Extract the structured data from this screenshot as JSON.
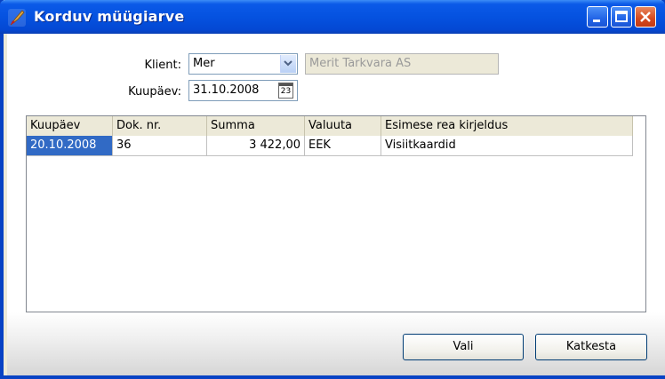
{
  "window": {
    "title": "Korduv müügiarve"
  },
  "form": {
    "client_label": "Klient:",
    "client_value": "Mer",
    "client_name": "Merit Tarkvara AS",
    "date_label": "Kuupäev:",
    "date_value": "31.10.2008",
    "calendar_text": "23"
  },
  "table": {
    "columns": [
      "Kuupäev",
      "Dok. nr.",
      "Summa",
      "Valuuta",
      "Esimese rea kirjeldus"
    ],
    "rows": [
      [
        "20.10.2008",
        "36",
        "3 422,00",
        "EEK",
        "Visiitkaardid"
      ]
    ]
  },
  "buttons": {
    "select": "Vali",
    "cancel": "Katkesta"
  },
  "colors": {
    "titlebar": "#0552E0",
    "selection": "#316AC5",
    "dialog_bg": "#ECE9D8"
  }
}
